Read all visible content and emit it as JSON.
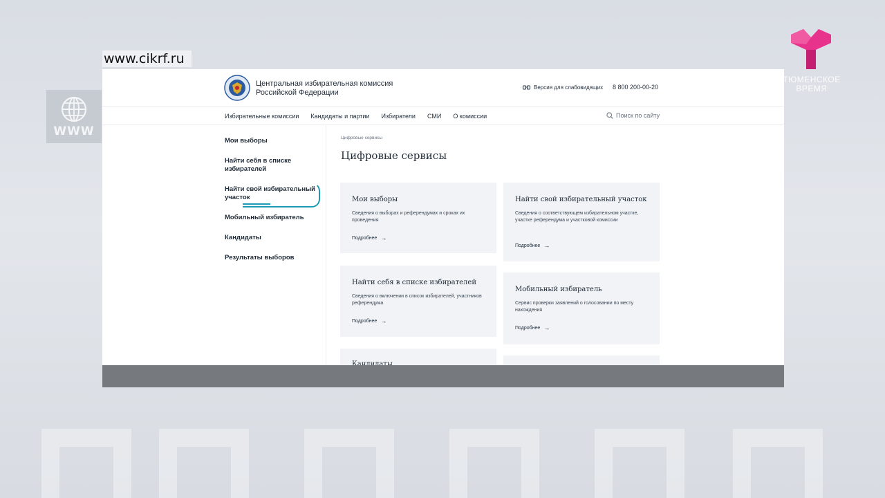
{
  "overlay": {
    "url": "www.cikrf.ru",
    "www_badge": "WWW",
    "channel_name": "ТЮМЕНСКОЕ ВРЕМЯ",
    "colors": {
      "channel_logo": "#e8338c",
      "highlight": "#1c9ab6",
      "card_bg": "#f1f3f6"
    }
  },
  "site": {
    "org_name_line1": "Центральная избирательная комиссия",
    "org_name_line2": "Российской Федерации",
    "low_vision_label": "Версия для слабовидящих",
    "phone": "8 800 200-00-20",
    "nav": [
      "Избирательные комиссии",
      "Кандидаты и партии",
      "Избиратели",
      "СМИ",
      "О комиссии"
    ],
    "search_placeholder": "Поиск по сайту",
    "side_menu": [
      "Мои выборы",
      "Найти себя в списке избирателей",
      "Найти свой избирательный участок",
      "Мобильный избиратель",
      "Кандидаты",
      "Результаты выборов"
    ],
    "breadcrumb": "Цифровые сервисы",
    "title": "Цифровые сервисы",
    "more_label": "Подробнее",
    "cards": [
      {
        "title": "Мои выборы",
        "desc": "Сведения о выборах и референдумах и сроках их проведения"
      },
      {
        "title": "Найти свой избирательный участок",
        "desc": "Сведения о соответствующем избирательном участке, участке референдума и участковой комиссии"
      },
      {
        "title": "Найти себя в списке избирателей",
        "desc": "Сведения о включении в список избирателей, участников референдума"
      },
      {
        "title": "Мобильный избиратель",
        "desc": "Сервис проверки заявлений о голосовании по месту нахождения"
      },
      {
        "title": "Кандидаты",
        "desc": ""
      }
    ]
  }
}
